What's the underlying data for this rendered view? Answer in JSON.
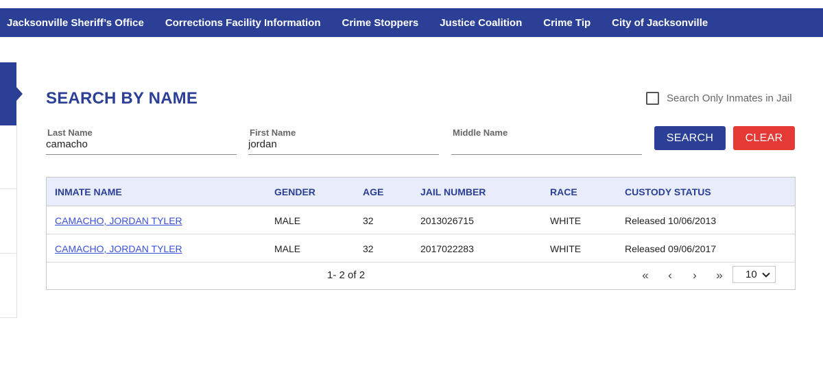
{
  "nav": {
    "items": [
      "Jacksonville Sheriff’s Office",
      "Corrections Facility Information",
      "Crime Stoppers",
      "Justice Coalition",
      "Crime Tip",
      "City of Jacksonville"
    ]
  },
  "search": {
    "title": "SEARCH BY NAME",
    "jail_only_label": "Search Only Inmates in Jail",
    "jail_only_checked": false,
    "last_name_label": "Last Name",
    "last_name_value": "camacho",
    "first_name_label": "First Name",
    "first_name_value": "jordan",
    "middle_name_label": "Middle Name",
    "middle_name_value": "",
    "search_label": "SEARCH",
    "clear_label": "CLEAR"
  },
  "results": {
    "columns": [
      "INMATE NAME",
      "GENDER",
      "AGE",
      "JAIL NUMBER",
      "RACE",
      "CUSTODY STATUS"
    ],
    "rows": [
      {
        "name": "CAMACHO, JORDAN TYLER",
        "gender": "MALE",
        "age": "32",
        "jail_number": "2013026715",
        "race": "WHITE",
        "status": "Released 10/06/2013"
      },
      {
        "name": "CAMACHO, JORDAN TYLER",
        "gender": "MALE",
        "age": "32",
        "jail_number": "2017022283",
        "race": "WHITE",
        "status": "Released 09/06/2017"
      }
    ],
    "pager": {
      "info": "1- 2 of 2",
      "first": "«",
      "prev": "‹",
      "next": "›",
      "last": "»",
      "page_size": "10"
    }
  },
  "colors": {
    "brand": "#2b3f96",
    "clear": "#e53935",
    "header_bg": "#e8ecfb",
    "link": "#3a4fd8"
  }
}
